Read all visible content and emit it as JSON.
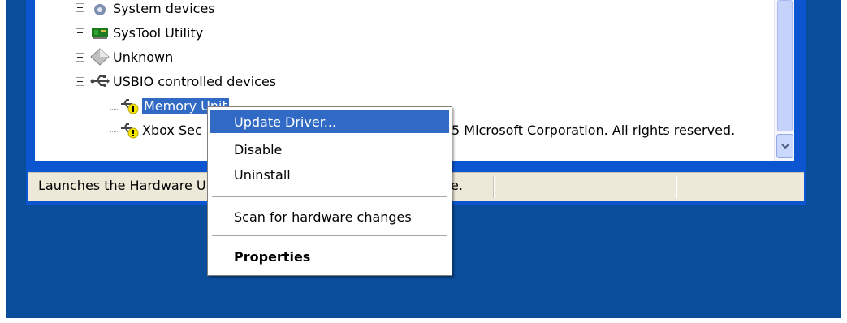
{
  "tree": {
    "items": [
      {
        "label": "System devices"
      },
      {
        "label": "SysTool Utility"
      },
      {
        "label": "Unknown"
      },
      {
        "label": "USBIO controlled devices"
      },
      {
        "label": "Memory Unit"
      },
      {
        "label": "Xbox Sec"
      }
    ],
    "overflow_text": "5 Microsoft Corporation. All rights reserved."
  },
  "status": {
    "text_left": "Launches the Hardware U",
    "text_right": "e."
  },
  "context_menu": {
    "items": [
      {
        "label": "Update Driver..."
      },
      {
        "label": "Disable"
      },
      {
        "label": "Uninstall"
      },
      {
        "label": "Scan for hardware changes"
      },
      {
        "label": "Properties"
      }
    ]
  },
  "colors": {
    "desktop": "#0a4d9b",
    "window_border": "#0b55d0",
    "selection": "#316ac5"
  }
}
